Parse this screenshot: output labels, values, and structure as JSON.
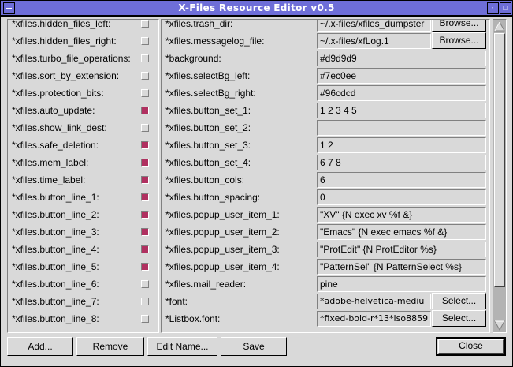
{
  "window": {
    "title": "X-Files Resource Editor v0.5"
  },
  "left_list": [
    {
      "label": "*xfiles.hidden_files_left:",
      "checked": false
    },
    {
      "label": "*xfiles.hidden_files_right:",
      "checked": false
    },
    {
      "label": "*xfiles.turbo_file_operations:",
      "checked": false
    },
    {
      "label": "*xfiles.sort_by_extension:",
      "checked": false
    },
    {
      "label": "*xfiles.protection_bits:",
      "checked": false
    },
    {
      "label": "*xfiles.auto_update:",
      "checked": true
    },
    {
      "label": "*xfiles.show_link_dest:",
      "checked": false
    },
    {
      "label": "*xfiles.safe_deletion:",
      "checked": true
    },
    {
      "label": "*xfiles.mem_label:",
      "checked": true
    },
    {
      "label": "*xfiles.time_label:",
      "checked": true
    },
    {
      "label": "*xfiles.button_line_1:",
      "checked": true
    },
    {
      "label": "*xfiles.button_line_2:",
      "checked": true
    },
    {
      "label": "*xfiles.button_line_3:",
      "checked": true
    },
    {
      "label": "*xfiles.button_line_4:",
      "checked": true
    },
    {
      "label": "*xfiles.button_line_5:",
      "checked": true
    },
    {
      "label": "*xfiles.button_line_6:",
      "checked": false
    },
    {
      "label": "*xfiles.button_line_7:",
      "checked": false
    },
    {
      "label": "*xfiles.button_line_8:",
      "checked": false
    }
  ],
  "right_list": [
    {
      "label": "*xfiles.trash_dir:",
      "value": "~/.x-files/xfiles_dumpster",
      "button": "Browse..."
    },
    {
      "label": "*xfiles.messagelog_file:",
      "value": "~/.x-files/xfLog.1",
      "button": "Browse..."
    },
    {
      "label": "*background:",
      "value": "#d9d9d9"
    },
    {
      "label": "*xfiles.selectBg_left:",
      "value": "#7ec0ee"
    },
    {
      "label": "*xfiles.selectBg_right:",
      "value": "#96cdcd"
    },
    {
      "label": "*xfiles.button_set_1:",
      "value": "1 2 3 4 5"
    },
    {
      "label": "*xfiles.button_set_2:",
      "value": ""
    },
    {
      "label": "*xfiles.button_set_3:",
      "value": "1 2"
    },
    {
      "label": "*xfiles.button_set_4:",
      "value": "6 7 8"
    },
    {
      "label": "*xfiles.button_cols:",
      "value": "6"
    },
    {
      "label": "*xfiles.button_spacing:",
      "value": "0"
    },
    {
      "label": "*xfiles.popup_user_item_1:",
      "value": "\"XV\" {N exec xv %f &}"
    },
    {
      "label": "*xfiles.popup_user_item_2:",
      "value": "\"Emacs\" {N exec emacs %f &}"
    },
    {
      "label": "*xfiles.popup_user_item_3:",
      "value": "\"ProtEdit\" {N ProtEditor %s}"
    },
    {
      "label": "*xfiles.popup_user_item_4:",
      "value": "\"PatternSel\" {N PatternSelect %s}"
    },
    {
      "label": "*xfiles.mail_reader:",
      "value": "pine"
    },
    {
      "label": "*font:",
      "value": "*adobe-helvetica-mediu",
      "button": "Select..."
    },
    {
      "label": "*Listbox.font:",
      "value": "*fixed-bold-r*13*iso8859",
      "button": "Select..."
    }
  ],
  "buttons": {
    "add": "Add...",
    "remove": "Remove",
    "edit_name": "Edit Name...",
    "save": "Save",
    "close": "Close"
  },
  "colors": {
    "titlebar": "#6e6ed8",
    "check_on": "#b03060",
    "background": "#d9d9d9"
  }
}
